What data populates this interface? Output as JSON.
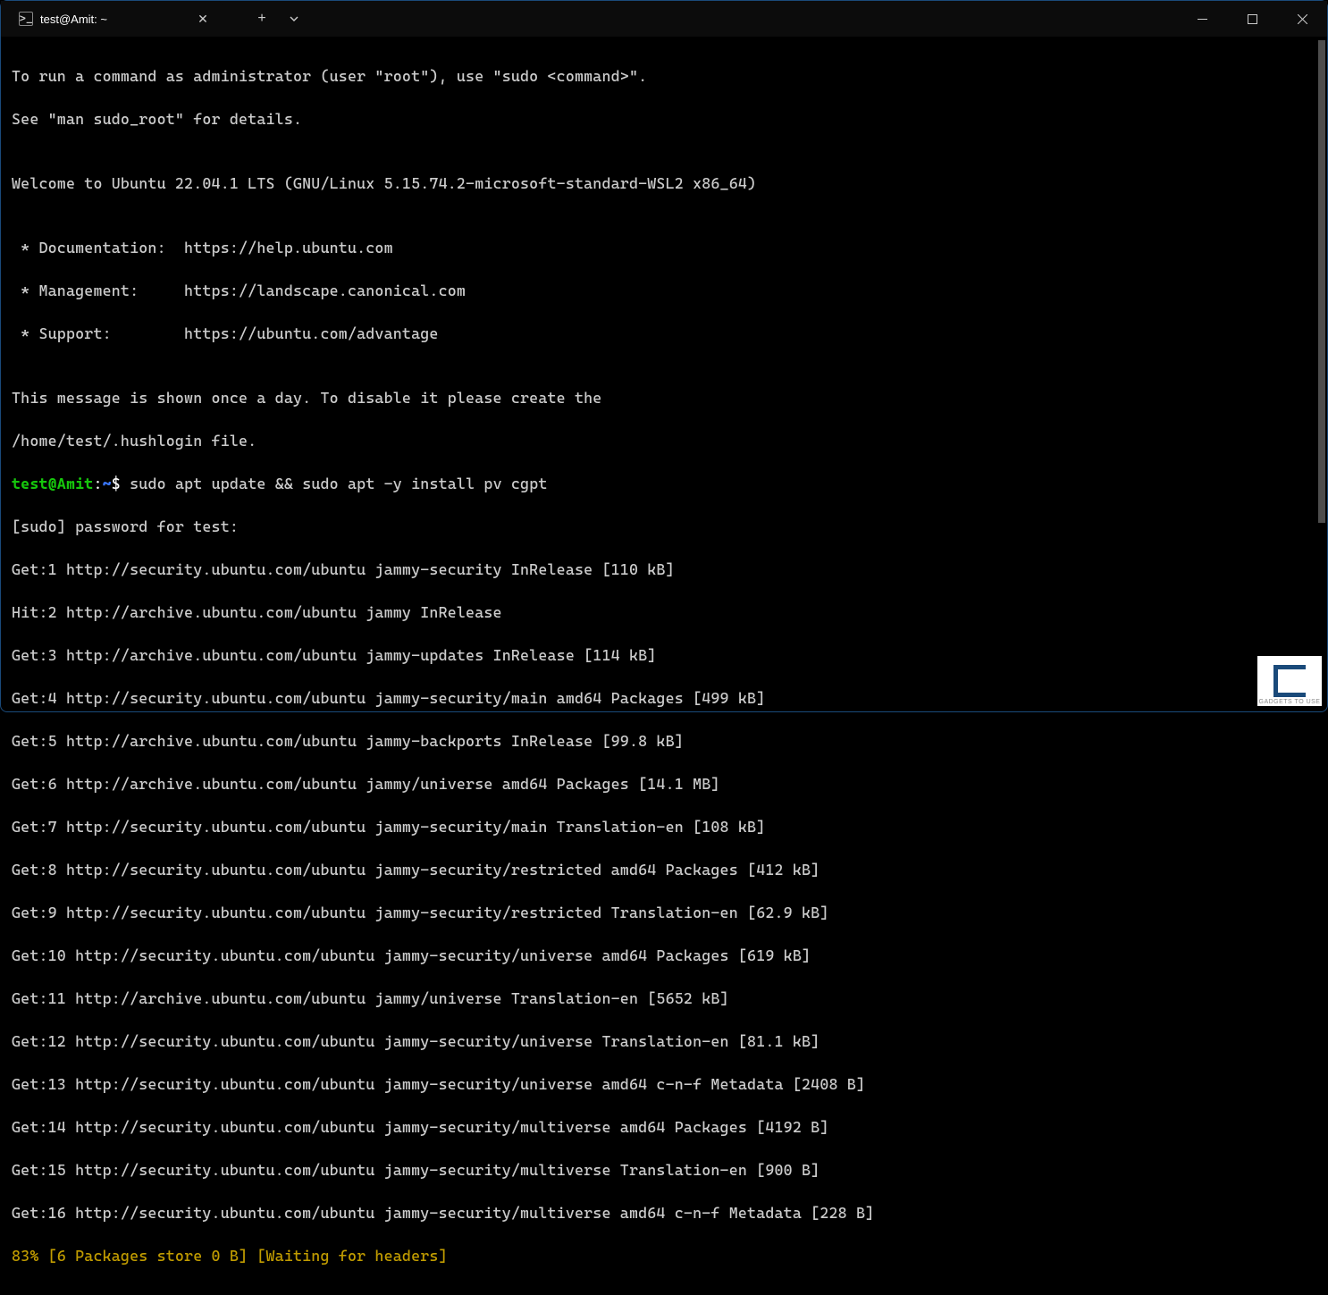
{
  "titlebar": {
    "tab_title": "test@Amit: ~",
    "tab_icon_glyph": ">_"
  },
  "motd": {
    "sudo_line1": "To run a command as administrator (user \"root\"), use \"sudo <command>\".",
    "sudo_line2": "See \"man sudo_root\" for details.",
    "blank1": "",
    "welcome": "Welcome to Ubuntu 22.04.1 LTS (GNU/Linux 5.15.74.2-microsoft-standard-WSL2 x86_64)",
    "blank2": "",
    "doc": " * Documentation:  https://help.ubuntu.com",
    "mgmt": " * Management:     https://landscape.canonical.com",
    "support": " * Support:        https://ubuntu.com/advantage",
    "blank3": "",
    "msg_once1": "This message is shown once a day. To disable it please create the",
    "msg_once2": "/home/test/.hushlogin file."
  },
  "prompt": {
    "user": "test@Amit",
    "colon": ":",
    "path": "~",
    "symbol": "$",
    "command": "sudo apt update && sudo apt -y install pv cgpt"
  },
  "output": {
    "sudo_pw": "[sudo] password for test:",
    "lines": [
      "Get:1 http://security.ubuntu.com/ubuntu jammy-security InRelease [110 kB]",
      "Hit:2 http://archive.ubuntu.com/ubuntu jammy InRelease",
      "Get:3 http://archive.ubuntu.com/ubuntu jammy-updates InRelease [114 kB]",
      "Get:4 http://security.ubuntu.com/ubuntu jammy-security/main amd64 Packages [499 kB]",
      "Get:5 http://archive.ubuntu.com/ubuntu jammy-backports InRelease [99.8 kB]",
      "Get:6 http://archive.ubuntu.com/ubuntu jammy/universe amd64 Packages [14.1 MB]",
      "Get:7 http://security.ubuntu.com/ubuntu jammy-security/main Translation-en [108 kB]",
      "Get:8 http://security.ubuntu.com/ubuntu jammy-security/restricted amd64 Packages [412 kB]",
      "Get:9 http://security.ubuntu.com/ubuntu jammy-security/restricted Translation-en [62.9 kB]",
      "Get:10 http://security.ubuntu.com/ubuntu jammy-security/universe amd64 Packages [619 kB]",
      "Get:11 http://archive.ubuntu.com/ubuntu jammy/universe Translation-en [5652 kB]",
      "Get:12 http://security.ubuntu.com/ubuntu jammy-security/universe Translation-en [81.1 kB]",
      "Get:13 http://security.ubuntu.com/ubuntu jammy-security/universe amd64 c-n-f Metadata [2408 B]",
      "Get:14 http://security.ubuntu.com/ubuntu jammy-security/multiverse amd64 Packages [4192 B]",
      "Get:15 http://security.ubuntu.com/ubuntu jammy-security/multiverse Translation-en [900 B]",
      "Get:16 http://security.ubuntu.com/ubuntu jammy-security/multiverse amd64 c-n-f Metadata [228 B]"
    ],
    "progress": "83% [6 Packages store 0 B] [Waiting for headers]"
  },
  "watermark": "GADGETS TO USE"
}
